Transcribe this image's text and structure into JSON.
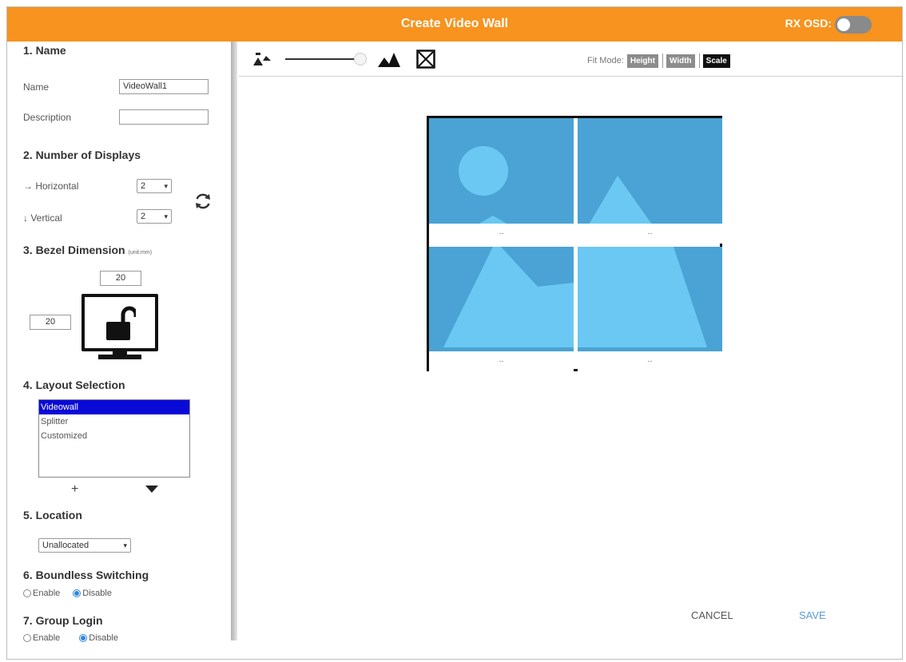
{
  "header": {
    "title": "Create Video Wall",
    "osd_label": "RX OSD:"
  },
  "sidebar": {
    "section_name": "1. Name",
    "name_label": "Name",
    "name_value": "VideoWall1",
    "description_label": "Description",
    "description_value": "",
    "section_displays": "2. Number of Displays",
    "horizontal_label": "→ Horizontal",
    "horizontal_value": "2",
    "vertical_label": "↓ Vertical",
    "vertical_value": "2",
    "section_bezel": "3. Bezel Dimension",
    "bezel_unit": "(unit:mm)",
    "bezel_top": "20",
    "bezel_left": "20",
    "section_layout": "4. Layout Selection",
    "layout_options": [
      "Videowall",
      "Splitter",
      "Customized"
    ],
    "layout_selected": "Videowall",
    "plus_label": "+",
    "section_location": "5. Location",
    "location_value": "Unallocated",
    "section_boundless": "6. Boundless Switching",
    "boundless_enable": "Enable",
    "boundless_disable": "Disable",
    "boundless_selected": "Disable",
    "section_group": "7. Group Login",
    "group_enable": "Enable",
    "group_disable": "Disable",
    "group_selected": "Disable"
  },
  "toolbar": {
    "fit_mode_label": "Fit Mode:",
    "fit_height": "Height",
    "fit_width": "Width",
    "fit_scale": "Scale",
    "fit_active": "Scale"
  },
  "wall": {
    "tile_captions": [
      "--",
      "--",
      "--",
      "--"
    ],
    "tile_color": "#4aa3d4"
  },
  "footer": {
    "cancel_label": "CANCEL",
    "save_label": "SAVE"
  },
  "colors": {
    "accent": "#f7931e",
    "selection": "#0a0ad8",
    "radio": "#2e86de",
    "link": "#5b9bd5"
  }
}
